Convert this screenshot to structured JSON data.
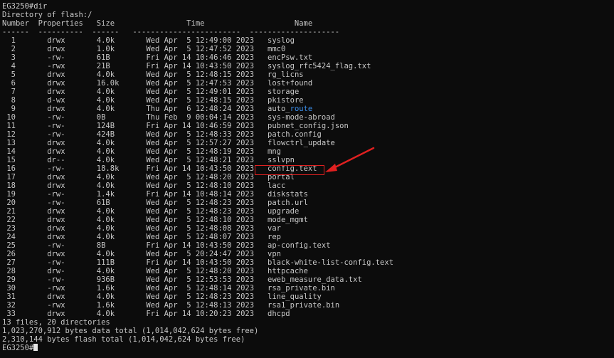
{
  "terminal": {
    "prompt_line": "EG3250#dir",
    "directory_line": "Directory of flash:/",
    "header_line": "Number  Properties   Size                Time                    Name",
    "separator_line": "------  ----------  ------   ------------------------  --------------------",
    "rows": [
      {
        "number": "1",
        "properties": "drwx",
        "size": "4.0k",
        "time": "Wed Apr  5 12:49:00 2023",
        "name": "syslog"
      },
      {
        "number": "2",
        "properties": "drwx",
        "size": "1.0k",
        "time": "Wed Apr  5 12:47:52 2023",
        "name": "mmc0"
      },
      {
        "number": "3",
        "properties": "-rw-",
        "size": "61B",
        "time": "Fri Apr 14 10:46:46 2023",
        "name": "encPsw.txt"
      },
      {
        "number": "4",
        "properties": "-rwx",
        "size": "21B",
        "time": "Fri Apr 14 10:43:50 2023",
        "name": "syslog_rfc5424_flag.txt"
      },
      {
        "number": "5",
        "properties": "drwx",
        "size": "4.0k",
        "time": "Wed Apr  5 12:48:15 2023",
        "name": "rg_licns"
      },
      {
        "number": "6",
        "properties": "drwx",
        "size": "16.0k",
        "time": "Wed Apr  5 12:47:53 2023",
        "name": "lost+found"
      },
      {
        "number": "7",
        "properties": "drwx",
        "size": "4.0k",
        "time": "Wed Apr  5 12:49:01 2023",
        "name": "storage"
      },
      {
        "number": "8",
        "properties": "d-wx",
        "size": "4.0k",
        "time": "Wed Apr  5 12:48:15 2023",
        "name": "pkistore"
      },
      {
        "number": "9",
        "properties": "drwx",
        "size": "4.0k",
        "time": "Thu Apr  6 12:48:24 2023",
        "name": "auto_route"
      },
      {
        "number": "10",
        "properties": "-rw-",
        "size": "0B",
        "time": "Thu Feb  9 00:04:14 2023",
        "name": "sys-mode-abroad"
      },
      {
        "number": "11",
        "properties": "-rw-",
        "size": "124B",
        "time": "Fri Apr 14 10:46:59 2023",
        "name": "pubnet_config.json"
      },
      {
        "number": "12",
        "properties": "-rw-",
        "size": "424B",
        "time": "Wed Apr  5 12:48:33 2023",
        "name": "patch.config"
      },
      {
        "number": "13",
        "properties": "drwx",
        "size": "4.0k",
        "time": "Wed Apr  5 12:57:27 2023",
        "name": "flowctrl_update"
      },
      {
        "number": "14",
        "properties": "drwx",
        "size": "4.0k",
        "time": "Wed Apr  5 12:48:19 2023",
        "name": "mng"
      },
      {
        "number": "15",
        "properties": "dr--",
        "size": "4.0k",
        "time": "Wed Apr  5 12:48:21 2023",
        "name": "sslvpn"
      },
      {
        "number": "16",
        "properties": "-rw-",
        "size": "18.8k",
        "time": "Fri Apr 14 10:43:50 2023",
        "name": "config.text"
      },
      {
        "number": "17",
        "properties": "drwx",
        "size": "4.0k",
        "time": "Wed Apr  5 12:48:20 2023",
        "name": "portal"
      },
      {
        "number": "18",
        "properties": "drwx",
        "size": "4.0k",
        "time": "Wed Apr  5 12:48:10 2023",
        "name": "lacc"
      },
      {
        "number": "19",
        "properties": "-rw-",
        "size": "1.4k",
        "time": "Fri Apr 14 10:48:14 2023",
        "name": "diskstats"
      },
      {
        "number": "20",
        "properties": "-rw-",
        "size": "61B",
        "time": "Wed Apr  5 12:48:23 2023",
        "name": "patch.url"
      },
      {
        "number": "21",
        "properties": "drwx",
        "size": "4.0k",
        "time": "Wed Apr  5 12:48:23 2023",
        "name": "upgrade"
      },
      {
        "number": "22",
        "properties": "drwx",
        "size": "4.0k",
        "time": "Wed Apr  5 12:48:10 2023",
        "name": "mode_mgmt"
      },
      {
        "number": "23",
        "properties": "drwx",
        "size": "4.0k",
        "time": "Wed Apr  5 12:48:08 2023",
        "name": "var"
      },
      {
        "number": "24",
        "properties": "drwx",
        "size": "4.0k",
        "time": "Wed Apr  5 12:48:07 2023",
        "name": "rep"
      },
      {
        "number": "25",
        "properties": "-rw-",
        "size": "8B",
        "time": "Fri Apr 14 10:43:50 2023",
        "name": "ap-config.text"
      },
      {
        "number": "26",
        "properties": "drwx",
        "size": "4.0k",
        "time": "Wed Apr  5 20:24:47 2023",
        "name": "vpn"
      },
      {
        "number": "27",
        "properties": "-rw-",
        "size": "111B",
        "time": "Fri Apr 14 10:43:50 2023",
        "name": "black-white-list-config.text"
      },
      {
        "number": "28",
        "properties": "drw-",
        "size": "4.0k",
        "time": "Wed Apr  5 12:48:20 2023",
        "name": "httpcache"
      },
      {
        "number": "29",
        "properties": "-rw-",
        "size": "936B",
        "time": "Wed Apr  5 12:53:53 2023",
        "name": "eweb_measure_data.txt"
      },
      {
        "number": "30",
        "properties": "-rwx",
        "size": "1.6k",
        "time": "Wed Apr  5 12:48:14 2023",
        "name": "rsa_private.bin"
      },
      {
        "number": "31",
        "properties": "drwx",
        "size": "4.0k",
        "time": "Wed Apr  5 12:48:23 2023",
        "name": "line_quality"
      },
      {
        "number": "32",
        "properties": "-rwx",
        "size": "1.6k",
        "time": "Wed Apr  5 12:48:13 2023",
        "name": "rsa1_private.bin"
      },
      {
        "number": "33",
        "properties": "drwx",
        "size": "4.0k",
        "time": "Fri Apr 14 10:20:23 2023",
        "name": "dhcpd"
      }
    ],
    "summary_files": "13 files, 20 directories",
    "summary_data": "1,023,270,912 bytes data total (1,014,042,624 bytes free)",
    "summary_flash": "2,310,144 bytes flash total (1,014,042,624 bytes free)",
    "final_prompt": "EG3250#",
    "highlighted_entry": "config.text",
    "colors": {
      "background": "#0c0c0c",
      "text": "#c8c8c8",
      "link": "#3b8eea",
      "annotation": "#e02020"
    }
  }
}
